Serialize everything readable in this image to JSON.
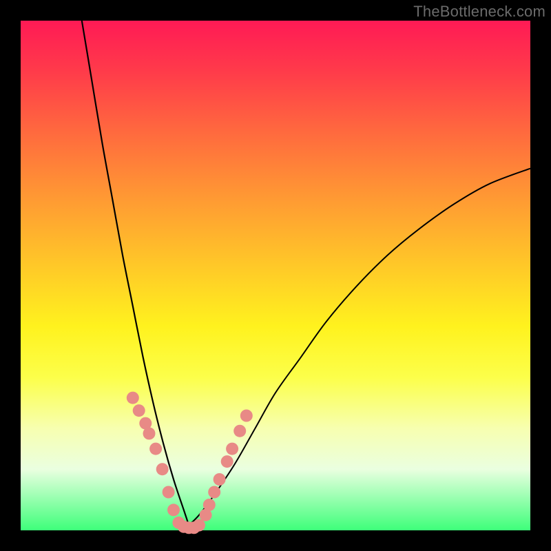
{
  "watermark": "TheBottleneck.com",
  "colors": {
    "background": "#000000",
    "curve": "#000000",
    "marker": "#e88a86",
    "gradient_stops": [
      "#ff1a55",
      "#ff3b4a",
      "#ff6a3e",
      "#ff9a33",
      "#ffc828",
      "#fff21e",
      "#fcff4a",
      "#f7ffb0",
      "#eaffe0",
      "#3eff7a"
    ]
  },
  "chart_data": {
    "type": "line",
    "title": "",
    "xlabel": "",
    "ylabel": "",
    "xlim": [
      0,
      100
    ],
    "ylim": [
      0,
      100
    ],
    "series": [
      {
        "name": "left-branch",
        "x": [
          12,
          14,
          16,
          18,
          20,
          22,
          24,
          26,
          28,
          30,
          32,
          33
        ],
        "values": [
          100,
          88,
          76,
          65,
          54,
          44,
          34,
          25,
          17,
          10,
          4,
          1
        ]
      },
      {
        "name": "right-branch",
        "x": [
          33,
          35,
          38,
          42,
          46,
          50,
          55,
          60,
          66,
          72,
          78,
          85,
          92,
          100
        ],
        "values": [
          1,
          3,
          7,
          13,
          20,
          27,
          34,
          41,
          48,
          54,
          59,
          64,
          68,
          71
        ]
      }
    ],
    "markers": {
      "name": "highlighted-points",
      "x_percent_of_plot": [
        22.0,
        23.2,
        24.5,
        25.2,
        26.5,
        27.8,
        29.0,
        30.0,
        31.0,
        32.0,
        33.0,
        34.0,
        35.0,
        36.3,
        37.0,
        38.0,
        39.0,
        40.5,
        41.5,
        43.0,
        44.3
      ],
      "y_percent_of_plot": [
        74.0,
        76.5,
        79.0,
        81.0,
        84.0,
        88.0,
        92.5,
        96.0,
        98.5,
        99.3,
        99.5,
        99.5,
        99.0,
        97.0,
        95.0,
        92.5,
        90.0,
        86.5,
        84.0,
        80.5,
        77.5
      ],
      "radius_px": 9
    }
  }
}
